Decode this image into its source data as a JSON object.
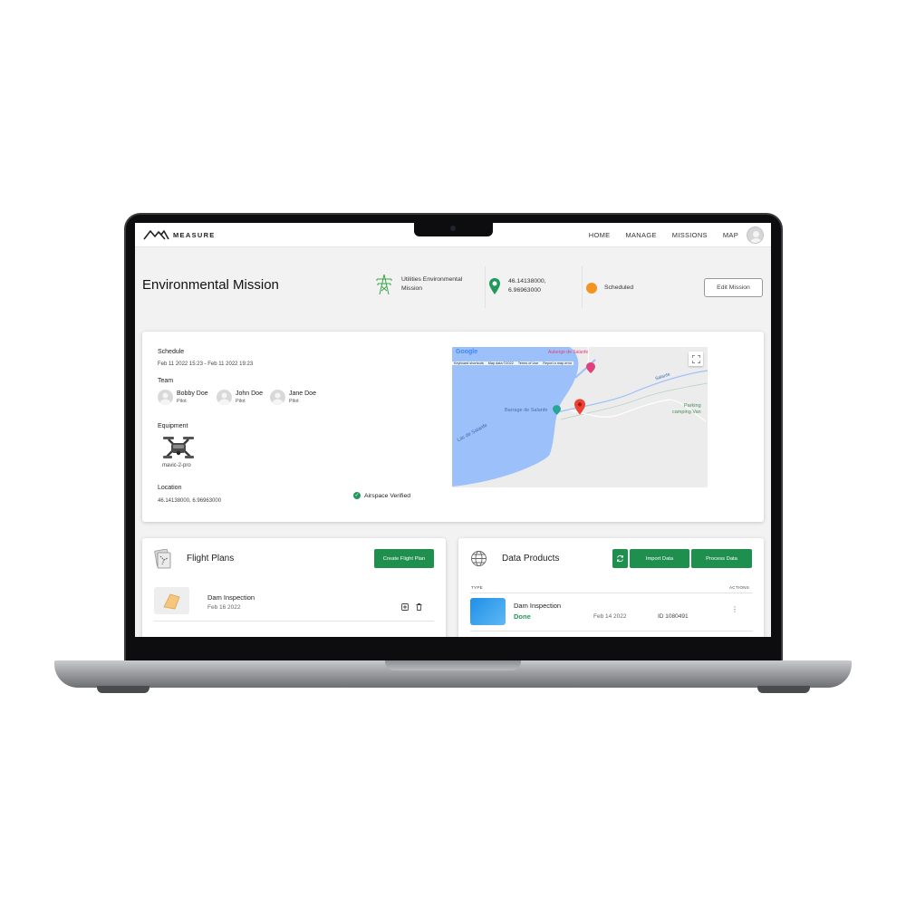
{
  "app": {
    "logo_text": "MEASURE",
    "nav": [
      "HOME",
      "MANAGE",
      "MISSIONS",
      "MAP"
    ]
  },
  "mission": {
    "title": "Environmental Mission",
    "type_line1": "Utilities Environmental",
    "type_line2": "Mission",
    "coords_line1": "46.14138000,",
    "coords_line2": "6.96963000",
    "status": "Scheduled",
    "edit_label": "Edit Mission"
  },
  "details": {
    "schedule_label": "Schedule",
    "schedule_value": "Feb 11 2022 15:23 - Feb 11 2022 19:23",
    "team_label": "Team",
    "team": [
      {
        "name": "Bobby Doe",
        "role": "Pilot"
      },
      {
        "name": "John Doe",
        "role": "Pilot"
      },
      {
        "name": "Jane Doe",
        "role": "Pilot"
      }
    ],
    "equipment_label": "Equipment",
    "equipment_name": "mavic-2-pro",
    "location_label": "Location",
    "location_value": "46.14138000, 6.96963000",
    "airspace_label": "Airspace Verified"
  },
  "map": {
    "google_text": "Google",
    "attribution": [
      "Keyboard shortcuts",
      "Map data ©2022",
      "Terms of Use",
      "Report a map error"
    ],
    "label_lake": "Lac de Salanfe",
    "label_dam": "Barrage de Salanfe",
    "label_river": "Salanfe",
    "label_top": "Auberge de Salanfe",
    "label_parking_1": "Parking",
    "label_parking_2": "camping Van"
  },
  "flight_plans": {
    "title": "Flight Plans",
    "create_label": "Create Flight Plan",
    "items": [
      {
        "name": "Dam Inspection",
        "date": "Feb 16 2022"
      }
    ]
  },
  "data_products": {
    "title": "Data Products",
    "import_label": "Import Data",
    "process_label": "Process Data",
    "col_type": "TYPE",
    "col_actions": "ACTIONS",
    "items": [
      {
        "name": "Dam Inspection",
        "status": "Done",
        "date": "Feb 14 2022",
        "id": "ID 1080491"
      }
    ]
  },
  "colors": {
    "accent_green": "#1f8f4e",
    "status_orange": "#f39322",
    "water_blue": "#9cc0f9"
  }
}
